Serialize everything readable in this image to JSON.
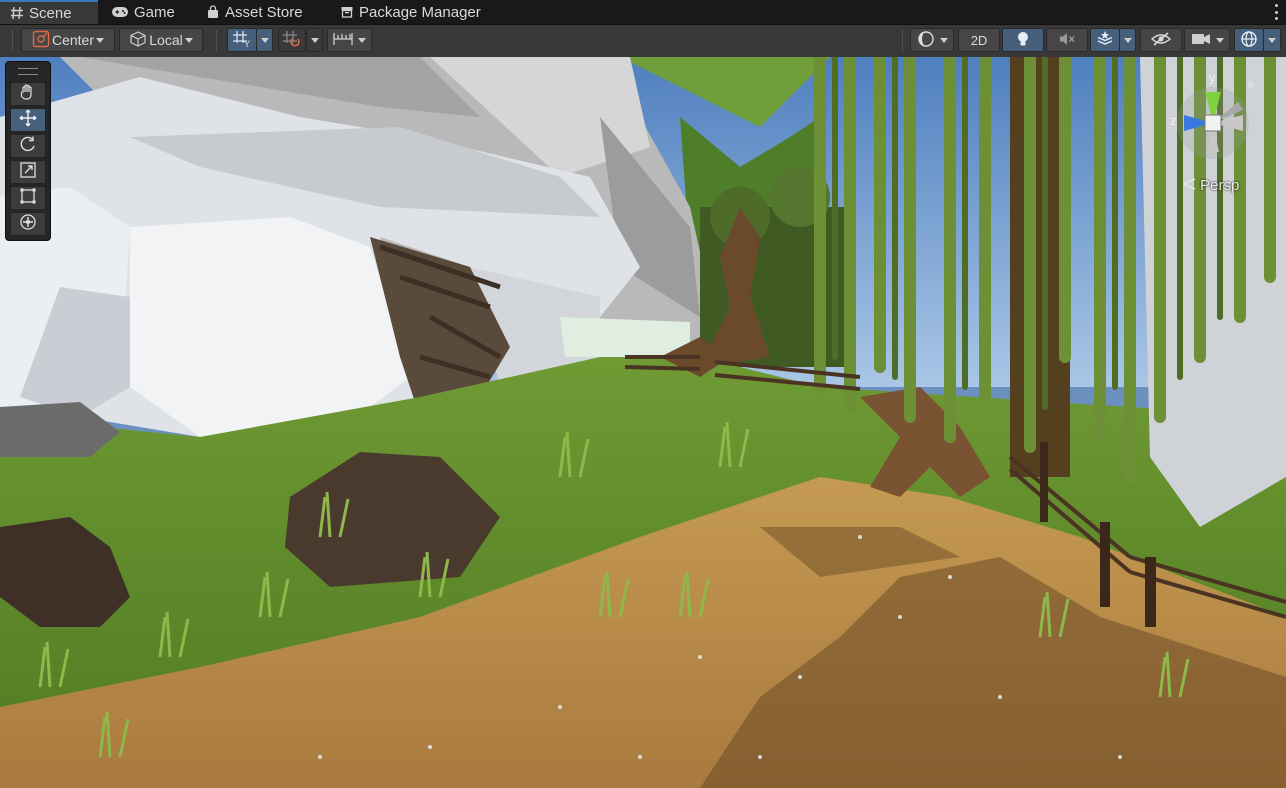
{
  "tabs": [
    {
      "label": "Scene",
      "icon": "hash-icon",
      "active": true
    },
    {
      "label": "Game",
      "icon": "gamepad-icon",
      "active": false
    },
    {
      "label": "Asset Store",
      "icon": "shopping-bag-icon",
      "active": false
    },
    {
      "label": "Package Manager",
      "icon": "package-icon",
      "active": false
    }
  ],
  "toolbar": {
    "pivot_label": "Center",
    "space_label": "Local",
    "mode_2d_label": "2D",
    "icons": [
      "pivot-icon",
      "local-space-icon",
      "grid-snap-icon",
      "increment-snap-icon",
      "ruler-icon",
      "shading-mode-icon",
      "lighting-icon",
      "audio-mute-icon",
      "effects-icon",
      "scene-visibility-icon",
      "camera-icon",
      "gizmos-icon"
    ]
  },
  "tools": [
    "hand-tool",
    "move-tool",
    "rotate-tool",
    "scale-tool",
    "rect-tool",
    "transform-tool"
  ],
  "active_tool": "move-tool",
  "gizmo": {
    "y_label": "y",
    "z_label": "z",
    "projection_label": "Persp"
  },
  "colors": {
    "accent_blue": "#46607c",
    "tab_active_border": "#3a79bb",
    "axis_y": "#7ed23b",
    "axis_z": "#3b79e0"
  }
}
